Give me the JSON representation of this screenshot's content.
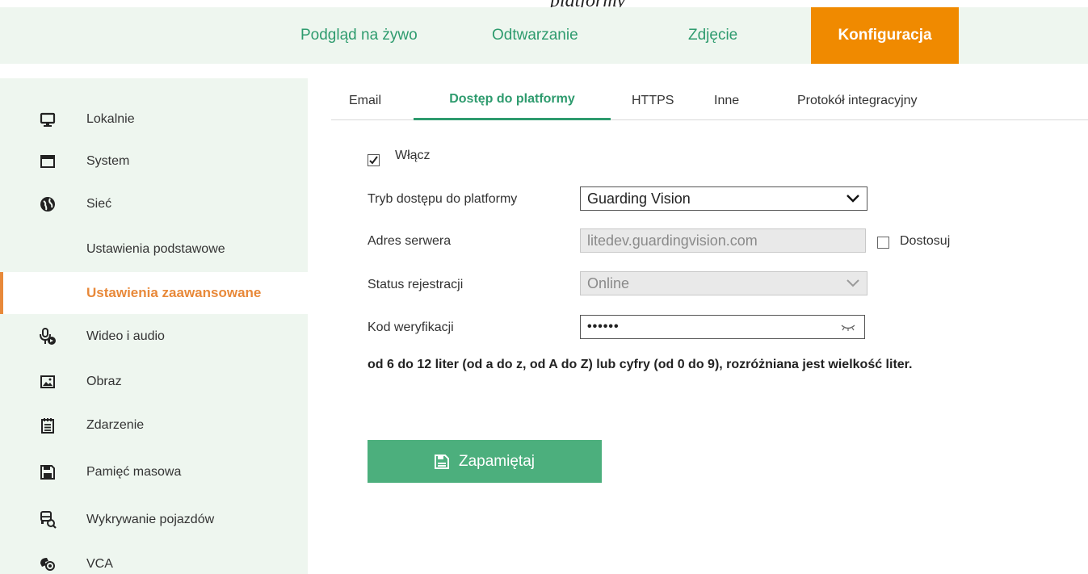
{
  "caption": "platformy",
  "topnav": {
    "items": [
      {
        "label": "Podgląd na żywo"
      },
      {
        "label": "Odtwarzanie"
      },
      {
        "label": "Zdjęcie"
      },
      {
        "label": "Konfiguracja",
        "active": true
      }
    ]
  },
  "sidebar": {
    "items": [
      {
        "label": "Lokalnie",
        "icon": "monitor-icon"
      },
      {
        "label": "System",
        "icon": "window-icon"
      },
      {
        "label": "Sieć",
        "icon": "globe-icon"
      },
      {
        "label": "Ustawienia podstawowe"
      },
      {
        "label": "Ustawienia zaawansowane",
        "active": true
      },
      {
        "label": "Wideo i audio",
        "icon": "microphone-icon"
      },
      {
        "label": "Obraz",
        "icon": "image-icon"
      },
      {
        "label": "Zdarzenie",
        "icon": "calendar-icon"
      },
      {
        "label": "Pamięć masowa",
        "icon": "floppy-icon"
      },
      {
        "label": "Wykrywanie pojazdów",
        "icon": "vehicle-search-icon"
      },
      {
        "label": "VCA",
        "icon": "vca-icon"
      }
    ]
  },
  "tabs": [
    {
      "label": "Email"
    },
    {
      "label": "Dostęp do platformy",
      "active": true
    },
    {
      "label": "HTTPS"
    },
    {
      "label": "Inne"
    },
    {
      "label": "Protokół integracyjny"
    }
  ],
  "form": {
    "enable": {
      "label": "Włącz",
      "checked": true
    },
    "access_mode": {
      "label": "Tryb dostępu do platformy",
      "value": "Guarding Vision"
    },
    "server_address": {
      "label": "Adres serwera",
      "value": "litedev.guardingvision.com",
      "customize_label": "Dostosuj",
      "customize_checked": false
    },
    "registration_status": {
      "label": "Status rejestracji",
      "value": "Online"
    },
    "verification_code": {
      "label": "Kod weryfikacji",
      "value": "••••••"
    },
    "hint": "od 6 do 12 liter (od a do z, od A do Z) lub cyfry (od 0 do 9), rozróżniana jest wielkość liter."
  },
  "save_button": {
    "label": "Zapamiętaj"
  },
  "colors": {
    "accent_green": "#2e9b6e",
    "accent_orange": "#f08a00",
    "sidebar_bg": "#eef6ef",
    "button_bg": "#4caf7d"
  }
}
